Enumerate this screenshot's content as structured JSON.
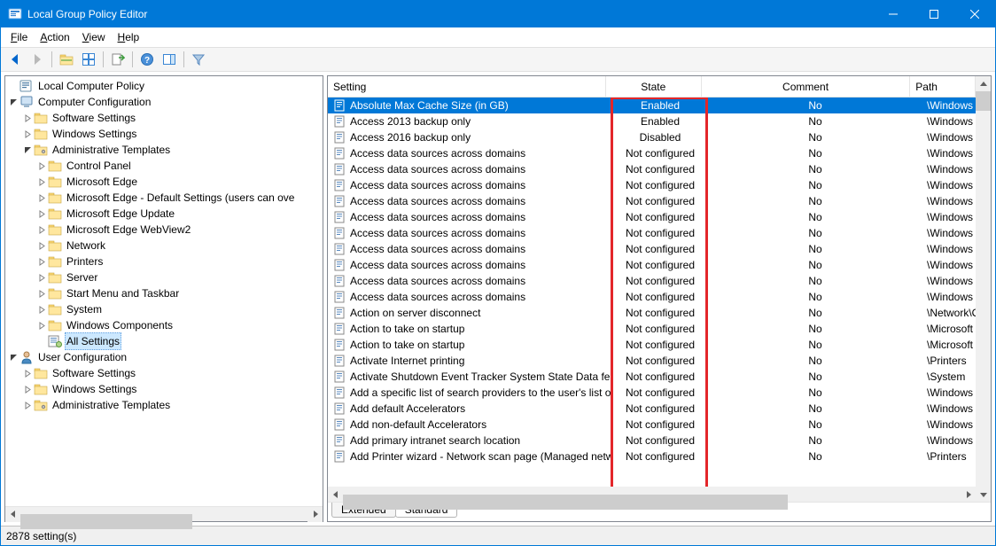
{
  "window": {
    "title": "Local Group Policy Editor",
    "min_tooltip": "Minimize",
    "max_tooltip": "Maximize",
    "close_tooltip": "Close"
  },
  "menubar": {
    "file": "File",
    "action": "Action",
    "view": "View",
    "help": "Help"
  },
  "toolbar": {
    "back": "Back",
    "forward": "Forward",
    "up": "Up",
    "show_hide": "Show/Hide Console Tree",
    "properties": "Properties",
    "refresh": "Refresh",
    "export": "Export List",
    "help": "Help",
    "action_pane": "Show/Hide Action Pane",
    "filter": "Filter"
  },
  "tree": {
    "root": "Local Computer Policy",
    "cc": "Computer Configuration",
    "cc_children": [
      "Software Settings",
      "Windows Settings"
    ],
    "admin_templates": "Administrative Templates",
    "at_children": [
      "Control Panel",
      "Microsoft Edge",
      "Microsoft Edge - Default Settings (users can ove",
      "Microsoft Edge Update",
      "Microsoft Edge WebView2",
      "Network",
      "Printers",
      "Server",
      "Start Menu and Taskbar",
      "System",
      "Windows Components"
    ],
    "all_settings": "All Settings",
    "uc": "User Configuration",
    "uc_children": [
      "Software Settings",
      "Windows Settings",
      "Administrative Templates"
    ]
  },
  "list": {
    "columns": {
      "setting": "Setting",
      "state": "State",
      "comment": "Comment",
      "path": "Path"
    },
    "rows": [
      {
        "setting": "Absolute Max Cache Size (in GB)",
        "state": "Enabled",
        "comment": "No",
        "path": "\\Windows Compor",
        "selected": true
      },
      {
        "setting": "Access 2013 backup only",
        "state": "Enabled",
        "comment": "No",
        "path": "\\Windows Compor"
      },
      {
        "setting": "Access 2016 backup only",
        "state": "Disabled",
        "comment": "No",
        "path": "\\Windows Compor"
      },
      {
        "setting": "Access data sources across domains",
        "state": "Not configured",
        "comment": "No",
        "path": "\\Windows Compor"
      },
      {
        "setting": "Access data sources across domains",
        "state": "Not configured",
        "comment": "No",
        "path": "\\Windows Compor"
      },
      {
        "setting": "Access data sources across domains",
        "state": "Not configured",
        "comment": "No",
        "path": "\\Windows Compor"
      },
      {
        "setting": "Access data sources across domains",
        "state": "Not configured",
        "comment": "No",
        "path": "\\Windows Compor"
      },
      {
        "setting": "Access data sources across domains",
        "state": "Not configured",
        "comment": "No",
        "path": "\\Windows Compor"
      },
      {
        "setting": "Access data sources across domains",
        "state": "Not configured",
        "comment": "No",
        "path": "\\Windows Compor"
      },
      {
        "setting": "Access data sources across domains",
        "state": "Not configured",
        "comment": "No",
        "path": "\\Windows Compor"
      },
      {
        "setting": "Access data sources across domains",
        "state": "Not configured",
        "comment": "No",
        "path": "\\Windows Compor"
      },
      {
        "setting": "Access data sources across domains",
        "state": "Not configured",
        "comment": "No",
        "path": "\\Windows Compor"
      },
      {
        "setting": "Access data sources across domains",
        "state": "Not configured",
        "comment": "No",
        "path": "\\Windows Compor"
      },
      {
        "setting": "Action on server disconnect",
        "state": "Not configured",
        "comment": "No",
        "path": "\\Network\\Offline F"
      },
      {
        "setting": "Action to take on startup",
        "state": "Not configured",
        "comment": "No",
        "path": "\\Microsoft Edge\\St"
      },
      {
        "setting": "Action to take on startup",
        "state": "Not configured",
        "comment": "No",
        "path": "\\Microsoft Edge - D"
      },
      {
        "setting": "Activate Internet printing",
        "state": "Not configured",
        "comment": "No",
        "path": "\\Printers"
      },
      {
        "setting": "Activate Shutdown Event Tracker System State Data feature",
        "state": "Not configured",
        "comment": "No",
        "path": "\\System"
      },
      {
        "setting": "Add a specific list of search providers to the user's list of sea...",
        "state": "Not configured",
        "comment": "No",
        "path": "\\Windows Compor"
      },
      {
        "setting": "Add default Accelerators",
        "state": "Not configured",
        "comment": "No",
        "path": "\\Windows Compor"
      },
      {
        "setting": "Add non-default Accelerators",
        "state": "Not configured",
        "comment": "No",
        "path": "\\Windows Compor"
      },
      {
        "setting": "Add primary intranet search location",
        "state": "Not configured",
        "comment": "No",
        "path": "\\Windows Compor"
      },
      {
        "setting": "Add Printer wizard - Network scan page (Managed network)",
        "state": "Not configured",
        "comment": "No",
        "path": "\\Printers"
      }
    ]
  },
  "tabs": {
    "extended": "Extended",
    "standard": "Standard"
  },
  "statusbar": {
    "text": "2878 setting(s)"
  }
}
